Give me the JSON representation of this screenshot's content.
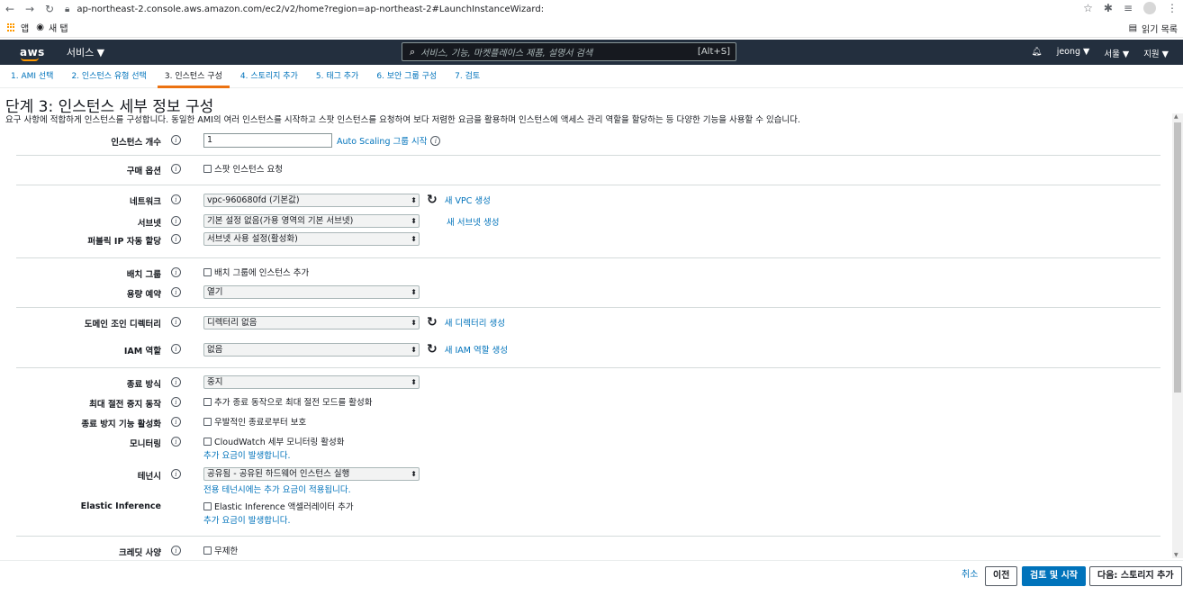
{
  "browser": {
    "url": "ap-northeast-2.console.aws.amazon.com/ec2/v2/home?region=ap-northeast-2#LaunchInstanceWizard:",
    "bookmarks": {
      "apps": "앱",
      "new_tab": "새 탭",
      "reading_list": "읽기 목록"
    }
  },
  "header": {
    "logo": "aws",
    "services": "서비스 ▼",
    "search_placeholder": "서비스, 기능, 마켓플레이스 제품, 설명서 검색",
    "search_shortcut": "[Alt+S]",
    "user": "jeong ▼",
    "region": "서울 ▼",
    "support": "지원 ▼"
  },
  "wizard_tabs": [
    {
      "label": "1. AMI 선택",
      "active": false
    },
    {
      "label": "2. 인스턴스 유형 선택",
      "active": false
    },
    {
      "label": "3. 인스턴스 구성",
      "active": true
    },
    {
      "label": "4. 스토리지 추가",
      "active": false
    },
    {
      "label": "5. 태그 추가",
      "active": false
    },
    {
      "label": "6. 보안 그룹 구성",
      "active": false
    },
    {
      "label": "7. 검토",
      "active": false
    }
  ],
  "page": {
    "title": "단계 3: 인스턴스 세부 정보 구성",
    "description": "요구 사항에 적합하게 인스턴스를 구성합니다. 동일한 AMI의 여러 인스턴스를 시작하고 스팟 인스턴스를 요청하여 보다 저렴한 요금을 활용하며 인스턴스에 액세스 관리 역할을 할당하는 등 다양한 기능을 사용할 수 있습니다."
  },
  "form": {
    "instance_count": {
      "label": "인스턴스 개수",
      "value": "1",
      "link": "Auto Scaling 그룹 시작"
    },
    "purchase": {
      "label": "구매 옵션",
      "checkbox": "스팟 인스턴스 요청"
    },
    "network": {
      "label": "네트워크",
      "value": "vpc-960680fd (기본값)",
      "link": "새 VPC 생성"
    },
    "subnet": {
      "label": "서브넷",
      "value": "기본 설정 없음(가용 영역의 기본 서브넷)",
      "link": "새 서브넷 생성"
    },
    "public_ip": {
      "label": "퍼블릭 IP 자동 할당",
      "value": "서브넷 사용 설정(활성화)"
    },
    "placement": {
      "label": "배치 그룹",
      "checkbox": "배치 그룹에 인스턴스 추가"
    },
    "capacity": {
      "label": "용량 예약",
      "value": "열기"
    },
    "domain": {
      "label": "도메인 조인 디렉터리",
      "value": "디렉터리 없음",
      "link": "새 디렉터리 생성"
    },
    "iam": {
      "label": "IAM 역할",
      "value": "없음",
      "link": "새 IAM 역할 생성"
    },
    "shutdown": {
      "label": "종료 방식",
      "value": "중지"
    },
    "hibernate": {
      "label": "최대 절전 중지 동작",
      "checkbox": "추가 종료 동작으로 최대 절전 모드를 활성화"
    },
    "termination": {
      "label": "종료 방지 기능 활성화",
      "checkbox": "우발적인 종료로부터 보호"
    },
    "monitoring": {
      "label": "모니터링",
      "checkbox": "CloudWatch 세부 모니터링 활성화",
      "note": "추가 요금이 발생합니다."
    },
    "tenancy": {
      "label": "테넌시",
      "value": "공유됨 - 공유된 하드웨어 인스턴스 실행",
      "note": "전용 테넌시에는 추가 요금이 적용됩니다."
    },
    "elastic": {
      "label": "Elastic Inference",
      "checkbox": "Elastic Inference 액셀러레이터 추가",
      "note": "추가 요금이 발생합니다."
    },
    "credit": {
      "label": "크레딧 사양",
      "checkbox": "무제한"
    }
  },
  "footer": {
    "cancel": "취소",
    "previous": "이전",
    "review_launch": "검토 및 시작",
    "next": "다음: 스토리지 추가"
  },
  "colors": {
    "header_bg": "#232f3e",
    "accent": "#ec7211",
    "link": "#0073bb",
    "primary_button": "#0073bb"
  }
}
